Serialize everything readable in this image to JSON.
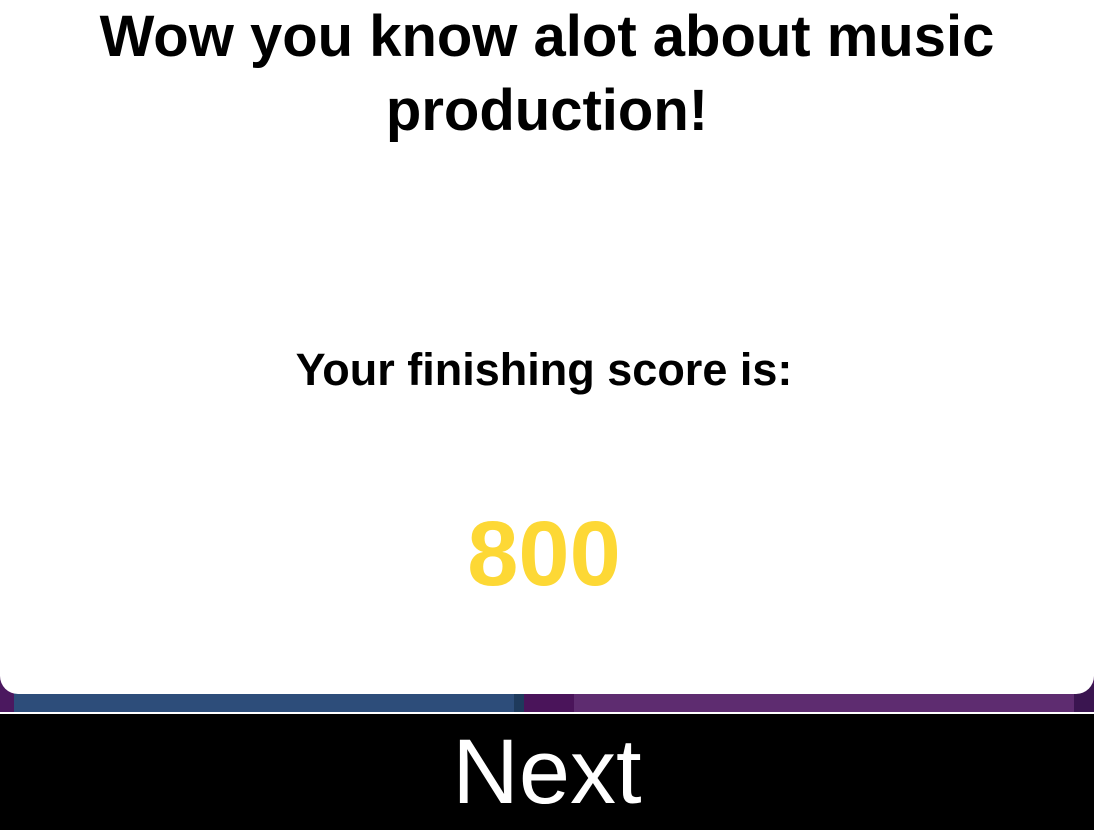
{
  "result": {
    "title": "Wow you know alot about music production!",
    "score_label": "Your finishing score is:",
    "score_value": "800"
  },
  "actions": {
    "next_label": "Next"
  },
  "colors": {
    "score": "#fdd835",
    "background": "#4b185f",
    "button": "#000000"
  }
}
